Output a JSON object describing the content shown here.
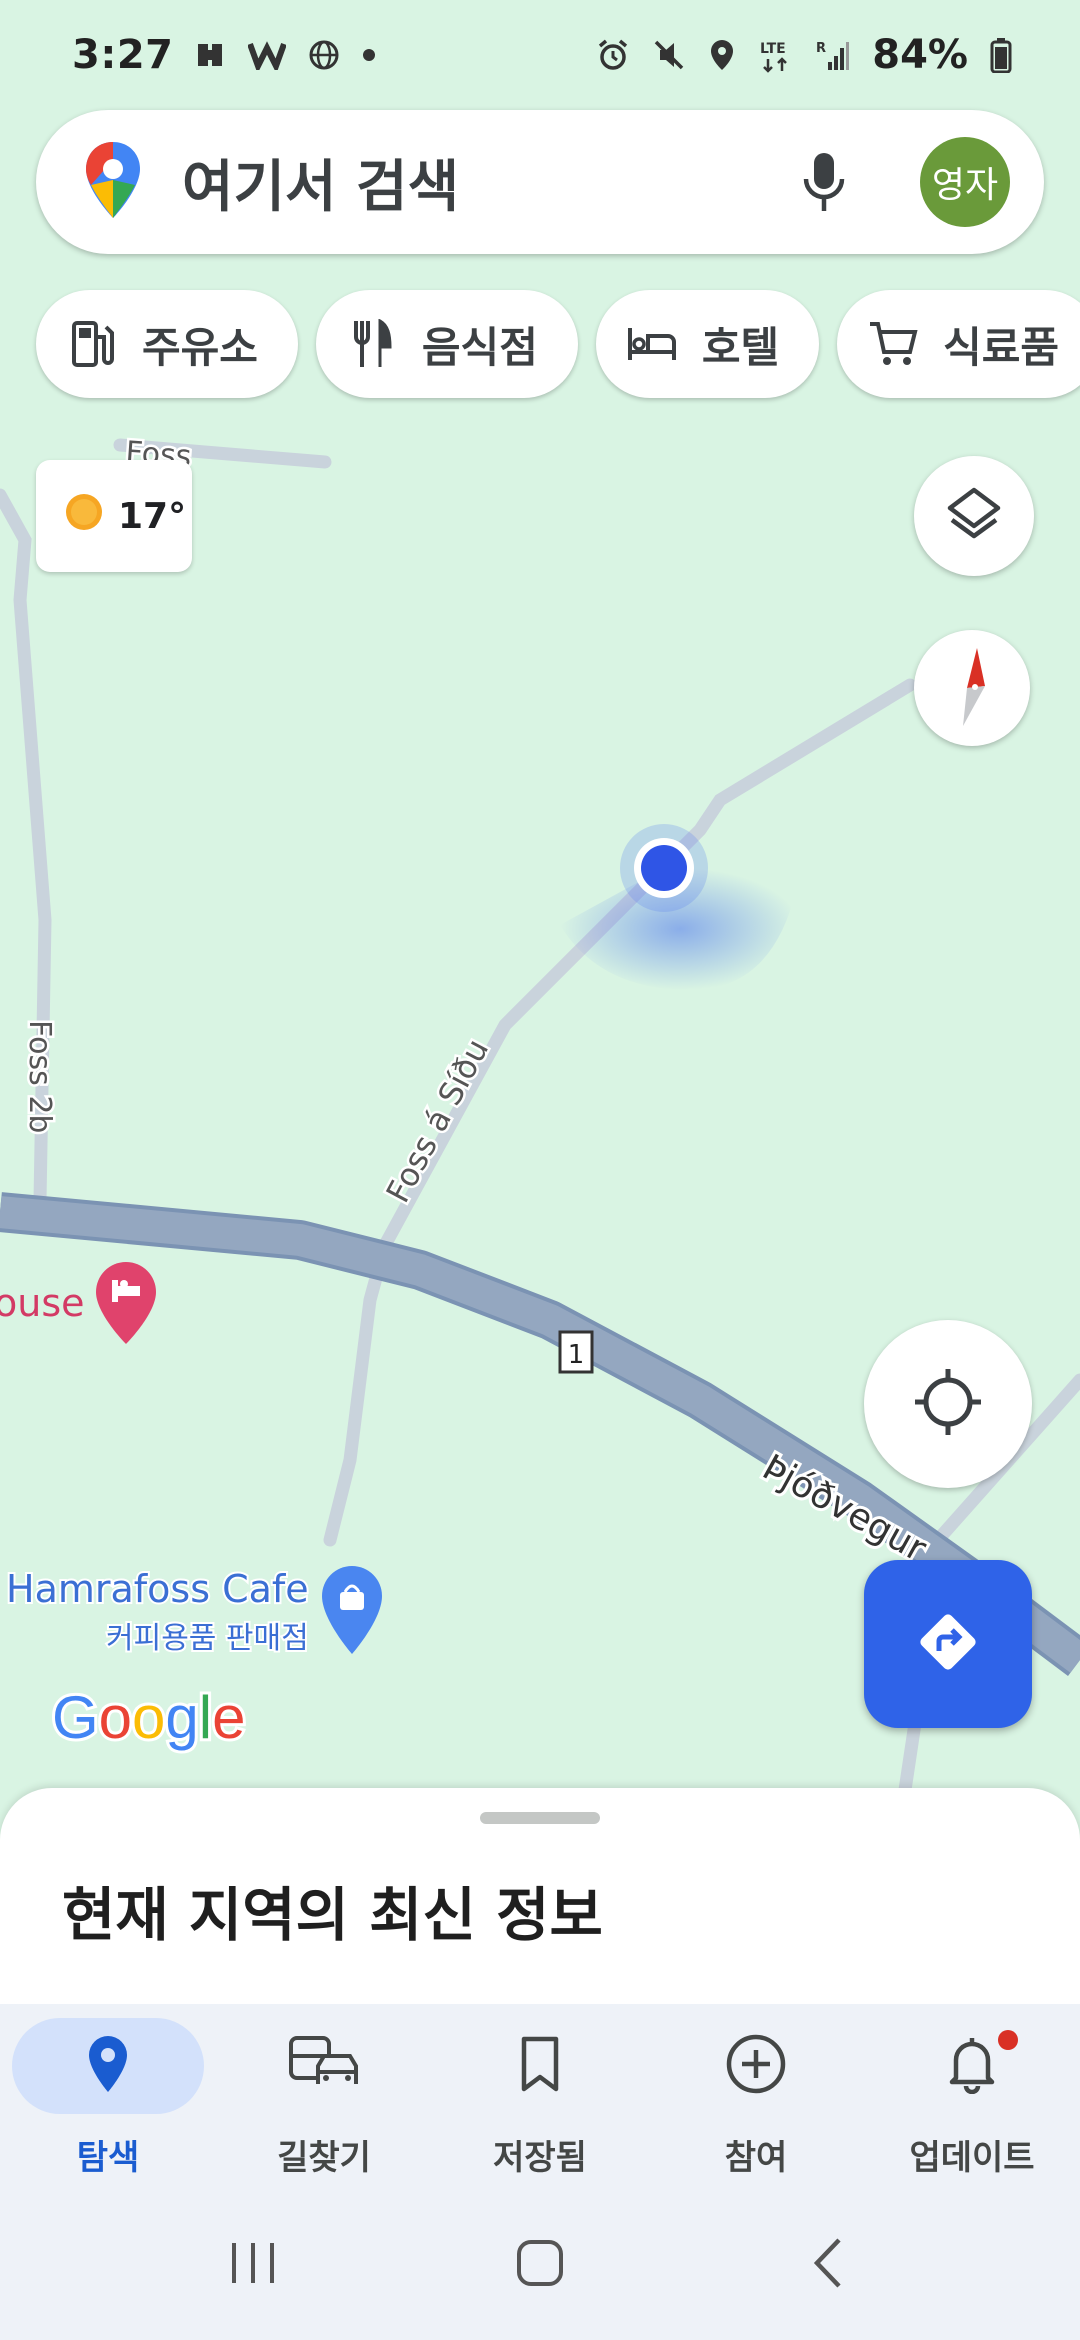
{
  "status_bar": {
    "time": "3:27",
    "battery": "84%",
    "left_icons": [
      "teams-icon",
      "w-app-icon",
      "globe-icon",
      "dot-icon"
    ],
    "right_icons": [
      "alarm-icon",
      "mute-icon",
      "location-icon",
      "lte-icon",
      "signal-icon",
      "battery-icon"
    ]
  },
  "search": {
    "placeholder": "여기서 검색",
    "avatar_text": "영자",
    "avatar_color": "#6a9a3a"
  },
  "chips": [
    {
      "label": "주유소",
      "icon": "gas-station-icon"
    },
    {
      "label": "음식점",
      "icon": "restaurant-icon"
    },
    {
      "label": "호텔",
      "icon": "hotel-icon"
    },
    {
      "label": "식료품",
      "icon": "cart-icon"
    }
  ],
  "weather": {
    "temp": "17°",
    "icon": "sun-icon"
  },
  "map": {
    "labels": {
      "foss_top": "Foss",
      "foss_2b": "Foss 2b",
      "foss_a_sidu": "Foss á Síðu",
      "route_number": "1",
      "pjodvegur": "Þjóðvegur",
      "house_partial": "ouse",
      "cafe_name": "Hamrafoss Cafe",
      "cafe_sub": "커피용품 판매점",
      "google": "Google"
    },
    "colors": {
      "land": "#d9f4e3",
      "minor_road": "#c9d3dc",
      "highway": "#8fa3bd",
      "location_dot": "#2f55e6",
      "hotel_pin": "#e0436c",
      "shop_pin": "#4285f4"
    }
  },
  "sheet": {
    "title": "현재 지역의 최신 정보"
  },
  "nav": [
    {
      "label": "탐색",
      "icon": "explore-pin-icon",
      "active": true
    },
    {
      "label": "길찾기",
      "icon": "commute-icon",
      "active": false
    },
    {
      "label": "저장됨",
      "icon": "bookmark-icon",
      "active": false
    },
    {
      "label": "참여",
      "icon": "add-circle-icon",
      "active": false
    },
    {
      "label": "업데이트",
      "icon": "bell-icon",
      "active": false,
      "badge": true
    }
  ],
  "accent": "#1a5cd0"
}
